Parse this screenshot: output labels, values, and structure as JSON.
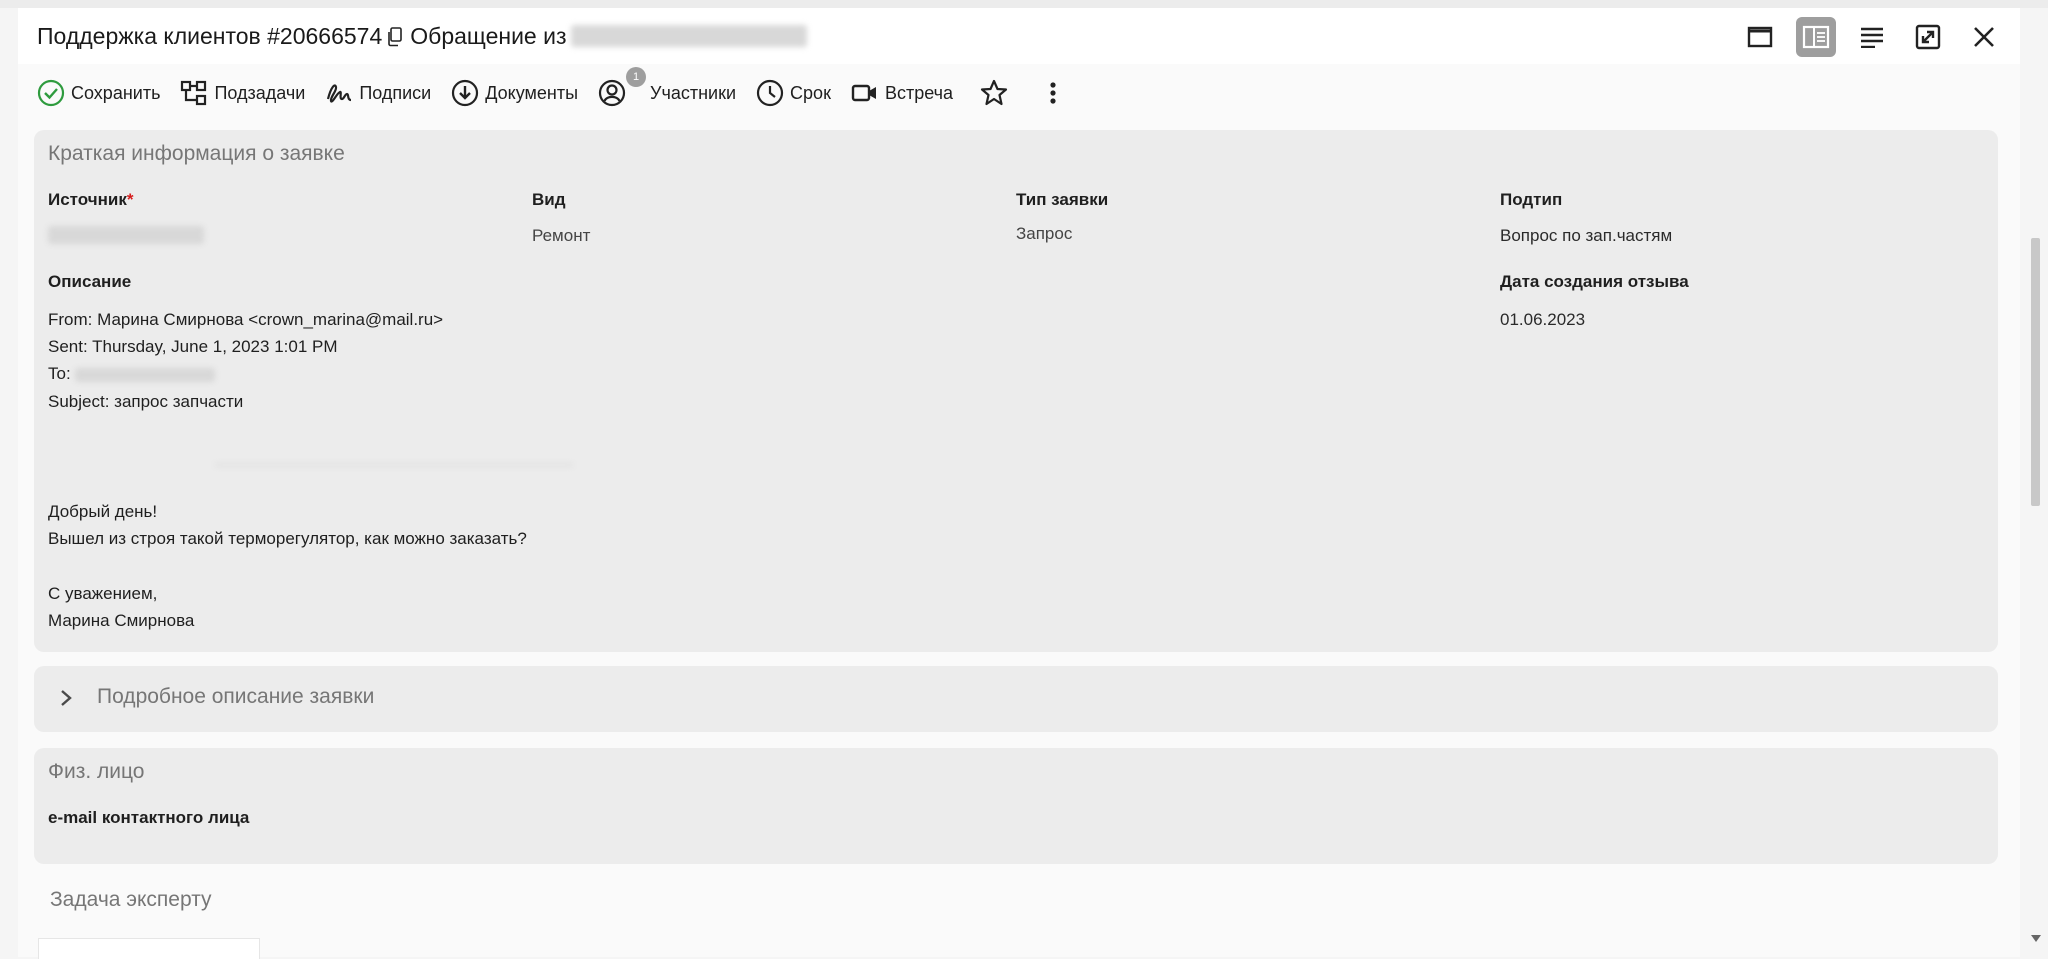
{
  "window": {
    "title_prefix": "Поддержка клиентов #20666574",
    "title_suffix": "Обращение из"
  },
  "toolbar": {
    "save": "Сохранить",
    "subtasks": "Подзадачи",
    "signatures": "Подписи",
    "documents": "Документы",
    "participants": "Участники",
    "participants_count": "1",
    "deadline": "Срок",
    "meeting": "Встреча"
  },
  "summary": {
    "title": "Краткая информация о заявке",
    "source_label": "Источник",
    "source_required": "*",
    "kind_label": "Вид",
    "kind_value": "Ремонт",
    "type_label": "Тип заявки",
    "type_value": "Запрос",
    "subtype_label": "Подтип",
    "subtype_value": "Вопрос по зап.частям",
    "description_label": "Описание",
    "created_label": "Дата создания отзыва",
    "created_value": "01.06.2023",
    "description_lines": [
      "From: Марина Смирнова <crown_marina@mail.ru>",
      "Sent: Thursday, June 1, 2023 1:01 PM",
      "To:",
      "Subject: запрос запчасти",
      "Добрый день!",
      "Вышел из строя такой терморегулятор, как можно заказать?",
      "С уважением,",
      "Марина Смирнова"
    ]
  },
  "details": {
    "title": "Подробное описание заявки"
  },
  "person": {
    "title": "Физ. лицо",
    "email_label": "e-mail контактного лица"
  },
  "expert": {
    "title": "Задача эксперту"
  }
}
